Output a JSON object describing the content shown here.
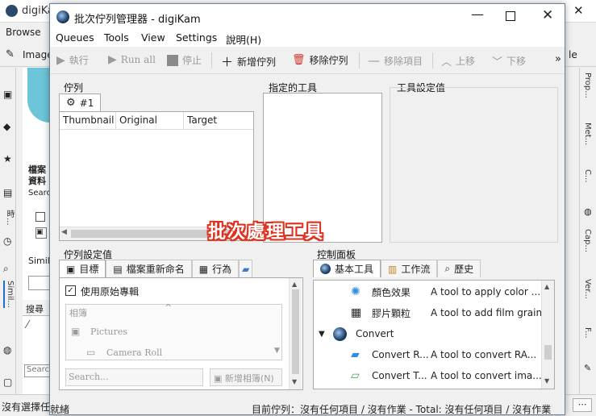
{
  "background_app": {
    "title": "digiKa",
    "menu_browse": "Browse",
    "toolbar_image": "Image",
    "toolbar_right": "le",
    "left_panel_texts": [
      "檔案",
      "資料",
      "Searc",
      "Simil",
      "搜尋",
      "Search"
    ],
    "left_vtab": "Simil...",
    "left_vtab2": "時...",
    "right_vtabs": [
      "Prop...",
      "Met...",
      "C...",
      "Cap...",
      "Ver...",
      "F..."
    ],
    "status_left": "沒有選擇任",
    "status_overlay": "就緒"
  },
  "dialog": {
    "title": "批次佇列管理器 - digiKam",
    "menu": [
      "Queues",
      "Tools",
      "View",
      "Settings",
      "說明(H)"
    ],
    "toolbar": {
      "run": "執行",
      "run_all": "Run all",
      "stop": "停止",
      "new_queue": "新增佇列",
      "remove_queue": "移除佇列",
      "remove_item": "移除項目",
      "up": "上移",
      "down": "下移",
      "more": "»"
    },
    "queues_group": {
      "title": "佇列",
      "tab": "#1",
      "columns": [
        "Thumbnail",
        "Original",
        "Target"
      ]
    },
    "assigned_tools": {
      "title": "指定的工具"
    },
    "tool_settings": {
      "title": "工具設定值"
    },
    "overlay_label": "批次處理工具",
    "queue_settings": {
      "title": "佇列設定值",
      "tabs": [
        "目標",
        "檔案重新命名",
        "行為"
      ],
      "checkbox_label": "使用原始專輯",
      "checkbox_checked": true,
      "album_header": "相簿",
      "albums": [
        "Pictures",
        "Camera Roll"
      ],
      "search_placeholder": "Search...",
      "new_album_button": "新增相簿(N)"
    },
    "control_panel": {
      "title": "控制面板",
      "tabs": [
        "基本工具",
        "工作流",
        "歷史"
      ],
      "tools": [
        {
          "name": "顏色效果",
          "desc": "A tool to apply color ...",
          "icon": "color-effect-icon"
        },
        {
          "name": "膠片顆粒",
          "desc": "A tool to add film grain",
          "icon": "film-grain-icon"
        },
        {
          "name": "Convert",
          "desc": "",
          "icon": "convert-group-icon"
        },
        {
          "name": "Convert R...",
          "desc": "A tool to convert RA...",
          "icon": "convert-raw-icon"
        },
        {
          "name": "Convert T...",
          "desc": "A tool to convert ima...",
          "icon": "convert-tiff-icon"
        }
      ]
    },
    "status": {
      "left": "就緒",
      "right": "目前佇列：沒有任何項目 / 沒有作業 - Total: 沒有任何項目 / 沒有作業"
    }
  },
  "colors": {
    "overlay_stroke": "#e0301e",
    "accent": "#1e6fd0"
  }
}
